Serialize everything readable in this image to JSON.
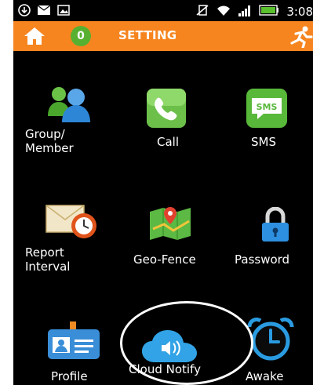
{
  "status_bar": {
    "time": "3:08",
    "left_icons": [
      "download-icon",
      "message-icon",
      "image-icon"
    ],
    "right_icons": [
      "no-sim-icon",
      "wifi-icon",
      "signal-icon",
      "battery-icon"
    ]
  },
  "app_bar": {
    "title": "SETTING",
    "count": "0",
    "colors": {
      "bar": "#f6851f",
      "badge": "#58b031"
    }
  },
  "tiles": [
    {
      "label_line1": "Group/",
      "label_line2": "Member",
      "icon": "group-members-icon"
    },
    {
      "label": "Call",
      "icon": "phone-icon"
    },
    {
      "label": "SMS",
      "icon": "sms-icon"
    },
    {
      "label_line1": "Report",
      "label_line2": "Interval",
      "icon": "report-interval-icon"
    },
    {
      "label": "Geo-Fence",
      "icon": "map-icon"
    },
    {
      "label": "Password",
      "icon": "lock-icon"
    },
    {
      "label": "Profile",
      "icon": "id-card-icon"
    },
    {
      "label": "Cloud Notify",
      "icon": "cloud-speaker-icon"
    },
    {
      "label": "Awake",
      "icon": "alarm-clock-icon"
    }
  ]
}
